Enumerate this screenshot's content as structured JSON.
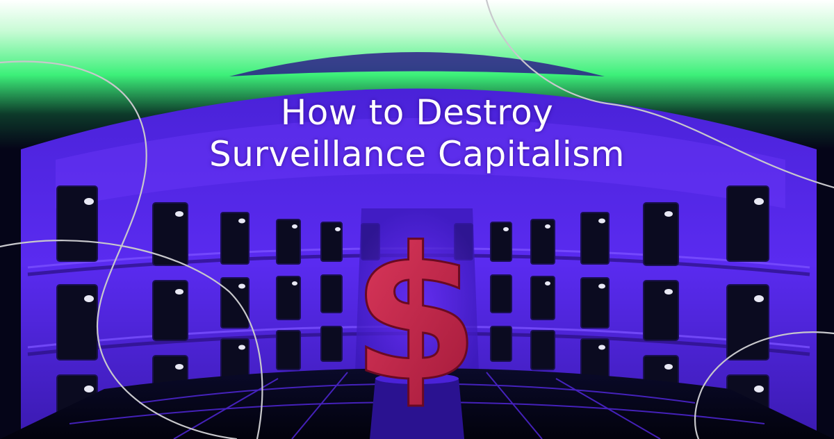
{
  "title": {
    "line1": "How to Destroy",
    "line2": "Surveillance Capitalism"
  },
  "symbol": "$",
  "colors": {
    "sky_green": "#3df07a",
    "wall_purple": "#5a2bf0",
    "dark_navy": "#0a0a2a",
    "dollar_red": "#c8284a",
    "line_gray": "#c8c8cc"
  }
}
